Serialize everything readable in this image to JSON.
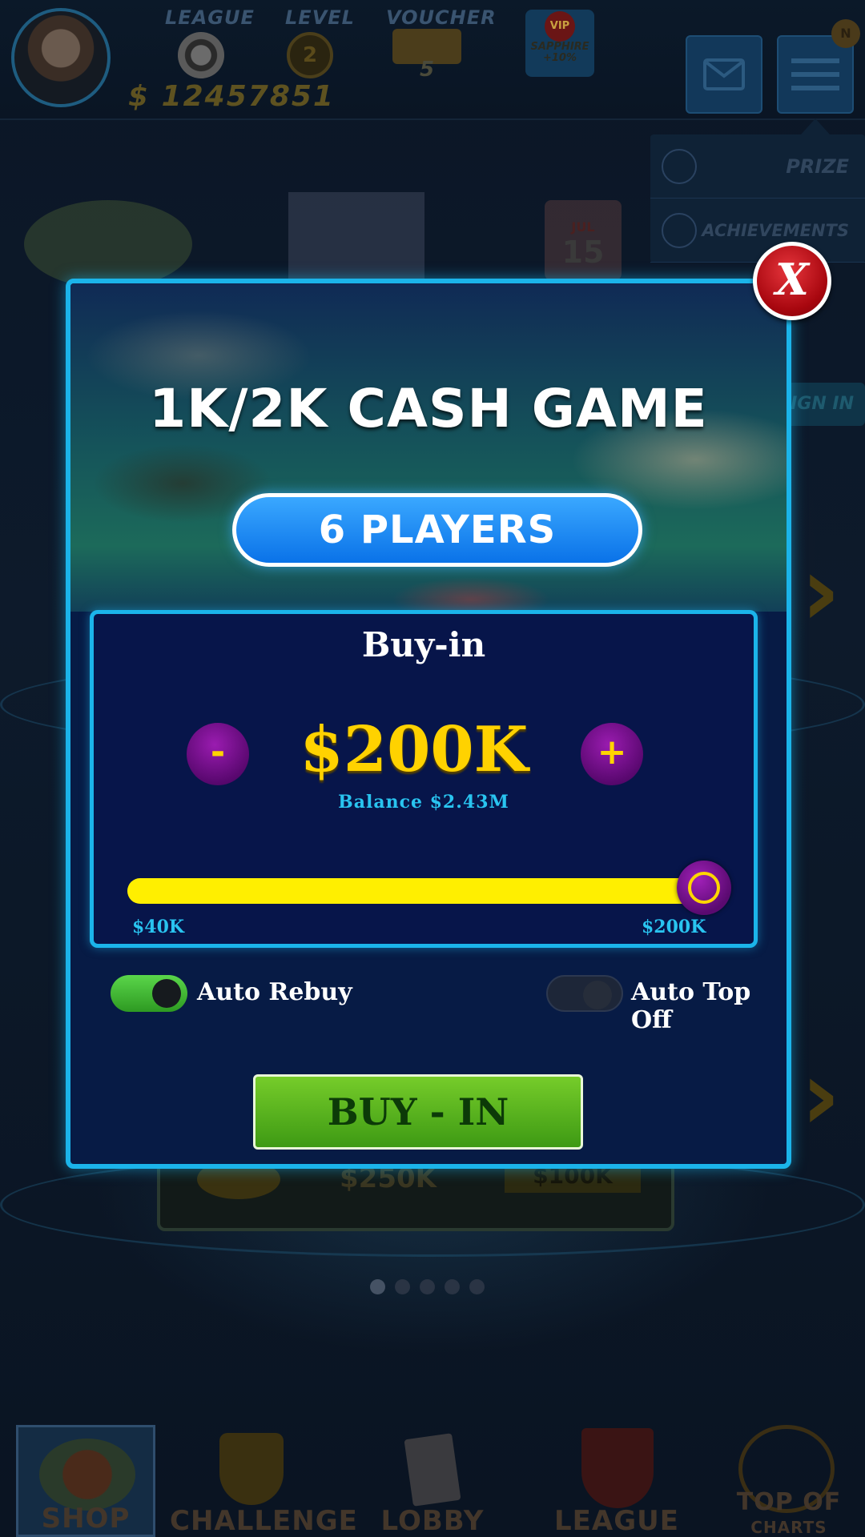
{
  "header": {
    "stats": [
      {
        "label": "LEAGUE",
        "icon": "poker-chip-icon"
      },
      {
        "label": "LEVEL",
        "icon": "level-star-icon",
        "value": "2"
      },
      {
        "label": "VOUCHER",
        "icon": "voucher-ticket-icon",
        "value": "5"
      }
    ],
    "vip": {
      "badge": "VIP",
      "tier": "SAPPHIRE",
      "bonus": "+10%"
    },
    "balance": "$ 12457851",
    "notification_badge": "N"
  },
  "menu_dropdown": {
    "items": [
      {
        "label": "PRIZE",
        "icon": "trophy-icon"
      },
      {
        "label": "ACHIEVEMENTS",
        "icon": "medal-icon"
      }
    ]
  },
  "background": {
    "sign_in": "SIGN IN",
    "card_amount": "$250K",
    "card_tag": "$100K",
    "calendar_month": "JUL",
    "calendar_day": "15",
    "page_dots": 5,
    "active_dot": 0
  },
  "bottom_nav": [
    {
      "label": "SHOP",
      "icon": "chips-stack-icon",
      "active": true
    },
    {
      "label": "CHALLENGE",
      "icon": "trophy-icon",
      "active": false
    },
    {
      "label": "LOBBY",
      "icon": "cards-icon",
      "active": false
    },
    {
      "label": "LEAGUE",
      "icon": "shield-arrows-icon",
      "active": false
    },
    {
      "label": "TOP OF",
      "sublabel": "CHARTS",
      "icon": "bar-chart-icon",
      "active": false
    }
  ],
  "modal": {
    "title": "1K/2K CASH GAME",
    "players": "6 PLAYERS",
    "buyin_heading": "Buy-in",
    "decrease_label": "-",
    "increase_label": "+",
    "amount": "$200K",
    "balance": "Balance $2.43M",
    "slider": {
      "min_label": "$40K",
      "max_label": "$200K",
      "min": 40,
      "max": 200,
      "value": 200
    },
    "auto_rebuy": {
      "label": "Auto Rebuy",
      "on": true
    },
    "auto_top_off": {
      "label": "Auto Top Off",
      "on": false
    },
    "buyin_button": "BUY - IN",
    "close_label": "X"
  },
  "colors": {
    "accent_border": "#1bb4ea",
    "amount_gold": "#ffd200",
    "slider_fill": "#ffef00",
    "buyin_button": "#5cb81e",
    "close_red": "#c0121a"
  }
}
